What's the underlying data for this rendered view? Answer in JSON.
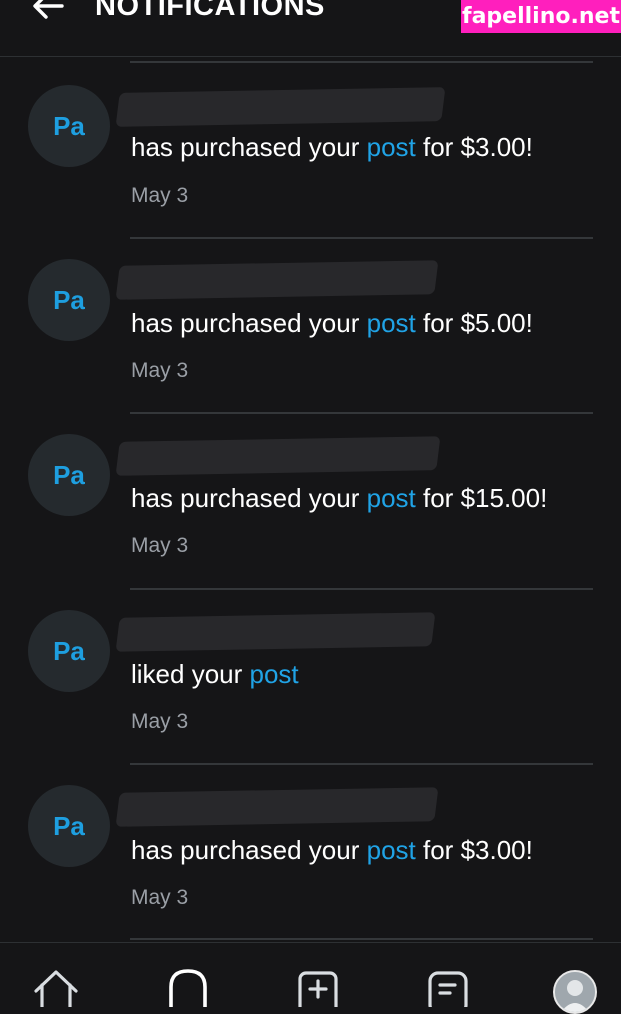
{
  "header": {
    "title": "NOTIFICATIONS",
    "back_icon": "arrow-left-icon"
  },
  "watermark": {
    "text": "fapellino.net",
    "color": "#ff1fbd"
  },
  "colors": {
    "background": "#151517",
    "link": "#20a3e6",
    "date": "#9a9fa6",
    "avatar_bg": "#252a2e",
    "avatar_text": "#1e9fe0"
  },
  "notifications": [
    {
      "avatar_initials": "Pa",
      "prefix": "has purchased your",
      "link": "post",
      "suffix": "for $3.00!",
      "date": "May 3"
    },
    {
      "avatar_initials": "Pa",
      "prefix": "has purchased your",
      "link": "post",
      "suffix": "for $5.00!",
      "date": "May 3"
    },
    {
      "avatar_initials": "Pa",
      "prefix": "has purchased your",
      "link": "post",
      "suffix": "for $15.00!",
      "date": "May 3"
    },
    {
      "avatar_initials": "Pa",
      "prefix": "liked your",
      "link": "post",
      "suffix": "",
      "date": "May 3"
    },
    {
      "avatar_initials": "Pa",
      "prefix": "has purchased your",
      "link": "post",
      "suffix": "for $3.00!",
      "date": "May 3"
    }
  ],
  "tabbar": {
    "tabs": [
      "home-icon",
      "notifications-icon",
      "add-post-icon",
      "messages-icon",
      "profile-avatar"
    ]
  }
}
